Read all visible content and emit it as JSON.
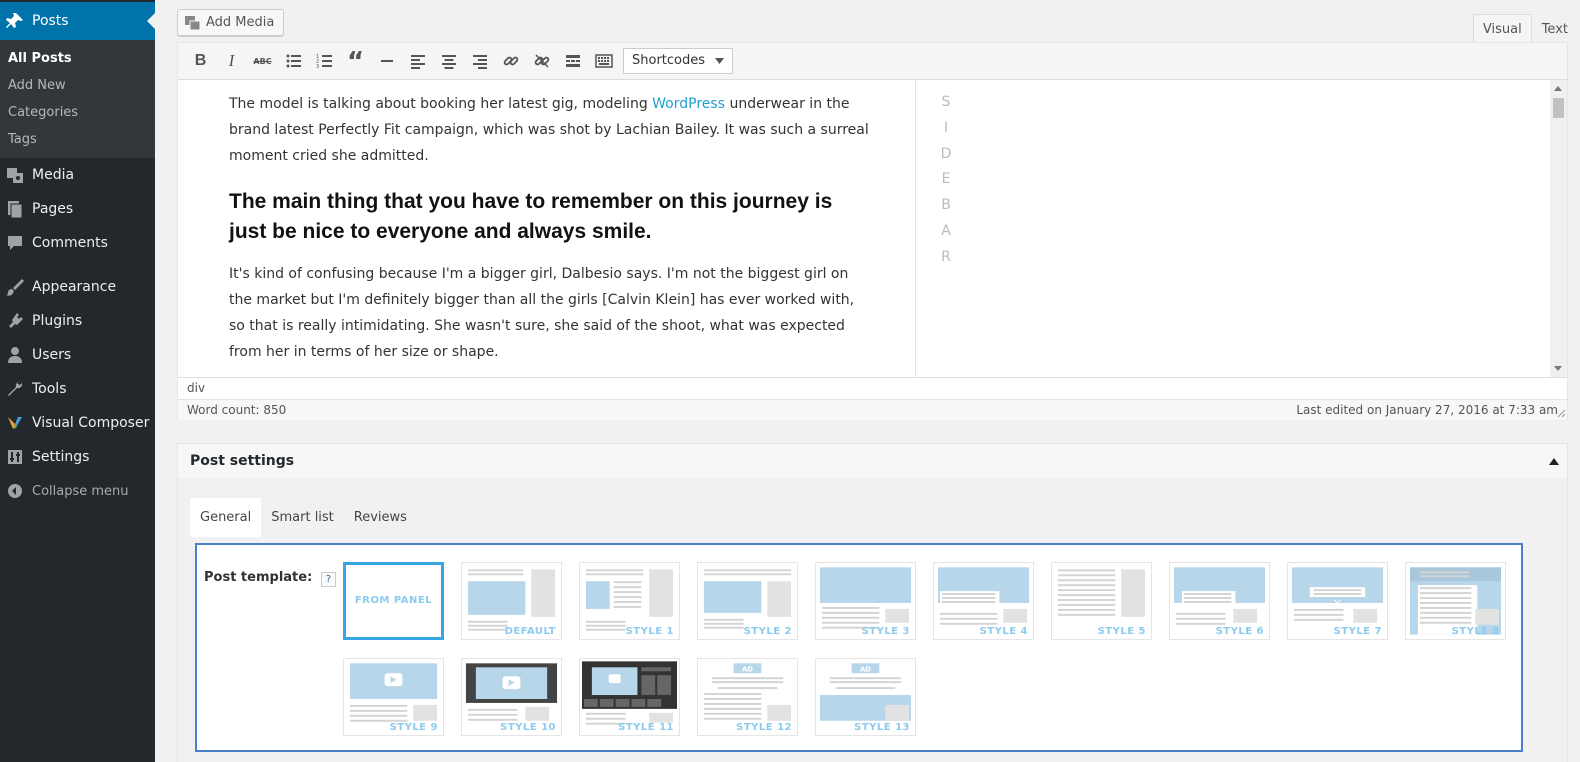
{
  "sidebar": {
    "posts": "Posts",
    "sub": [
      "All Posts",
      "Add New",
      "Categories",
      "Tags"
    ],
    "items": [
      "Media",
      "Pages",
      "Comments",
      "Appearance",
      "Plugins",
      "Users",
      "Tools",
      "Visual Composer",
      "Settings"
    ],
    "collapse": "Collapse menu"
  },
  "editor": {
    "add_media": "Add Media",
    "tab_visual": "Visual",
    "tab_text": "Text",
    "shortcodes": "Shortcodes",
    "content": {
      "p1_a": "The model is talking about booking her latest gig, modeling ",
      "p1_link": "WordPress",
      "p1_b": " underwear in the brand latest Perfectly Fit campaign, which was shot by Lachian Bailey. It was such a surreal moment cried she admitted.",
      "heading": "The main thing that you have to remember on this journey is just be nice to everyone and always smile.",
      "p2": "It's kind of confusing because I'm a bigger girl, Dalbesio says. I'm not the biggest girl on the market but I'm definitely bigger than all the girls [Calvin Klein] has ever worked with, so that is really intimidating. She wasn't sure, she said of the shoot, what was expected from her in terms of her size or shape."
    },
    "sidebar_letters": [
      "S",
      "I",
      "D",
      "E",
      "B",
      "A",
      "R"
    ],
    "path": "div",
    "word_count": "Word count: 850",
    "last_edited": "Last edited on January 27, 2016 at 7:33 am"
  },
  "post_settings": {
    "title": "Post settings",
    "tabs": [
      "General",
      "Smart list",
      "Reviews"
    ],
    "template_label": "Post template:",
    "help": "?",
    "templates": [
      {
        "label": "FROM PANEL"
      },
      {
        "label": "DEFAULT"
      },
      {
        "label": "STYLE 1"
      },
      {
        "label": "STYLE 2"
      },
      {
        "label": "STYLE 3"
      },
      {
        "label": "STYLE 4"
      },
      {
        "label": "STYLE 5"
      },
      {
        "label": "STYLE 6"
      },
      {
        "label": "STYLE 7"
      },
      {
        "label": "STYLE 8"
      },
      {
        "label": "STYLE 9"
      },
      {
        "label": "STYLE 10"
      },
      {
        "label": "STYLE 11"
      },
      {
        "label": "STYLE 12"
      },
      {
        "label": "STYLE 13"
      }
    ]
  }
}
